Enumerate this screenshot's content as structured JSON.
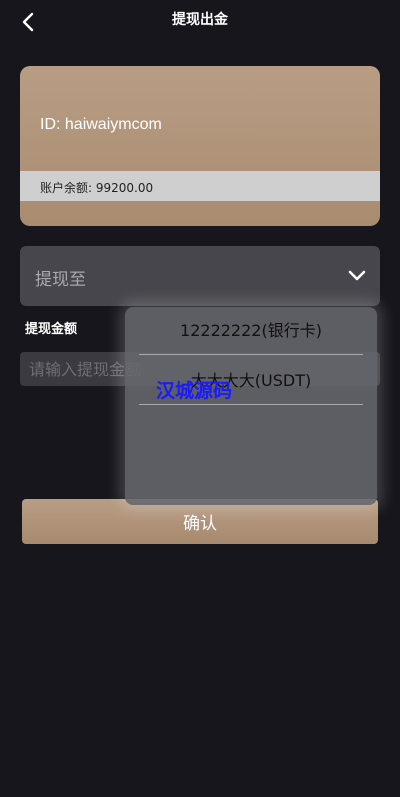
{
  "header": {
    "title": "提现出金",
    "back_icon": "chevron-left-icon"
  },
  "account_card": {
    "id_text": "ID: haiwaiymcom",
    "balance_text": "账户余额: 99200.00"
  },
  "withdraw_to": {
    "label": "提现至",
    "icon": "chevron-down-icon"
  },
  "amount": {
    "label": "提现金额",
    "placeholder": "请输入提现金额",
    "value": ""
  },
  "dropdown": {
    "options": [
      {
        "label": "12222222(银行卡)"
      },
      {
        "label": "大大大大(USDT)"
      }
    ]
  },
  "watermark": "汉城源码",
  "confirm_label": "确认",
  "colors": {
    "background": "#16161c",
    "accent": "#b09379",
    "watermark": "#1a1aff"
  }
}
